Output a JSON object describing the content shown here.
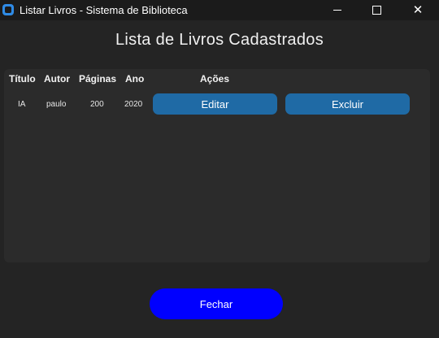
{
  "window": {
    "title": "Listar Livros - Sistema de Biblioteca",
    "minimize_icon": "minimize-icon",
    "maximize_icon": "maximize-icon",
    "close_icon": "close-icon",
    "close_glyph": "✕"
  },
  "page": {
    "heading": "Lista de Livros Cadastrados"
  },
  "table": {
    "headers": [
      "Título",
      "Autor",
      "Páginas",
      "Ano",
      "Ações"
    ],
    "rows": [
      {
        "titulo": "IA",
        "autor": "paulo",
        "paginas": "200",
        "ano": "2020",
        "edit_label": "Editar",
        "delete_label": "Excluir"
      }
    ]
  },
  "footer": {
    "close_label": "Fechar"
  },
  "colors": {
    "background": "#242424",
    "panel": "#2b2b2b",
    "action_button": "#1f6aa5",
    "close_button": "#0000ff"
  }
}
